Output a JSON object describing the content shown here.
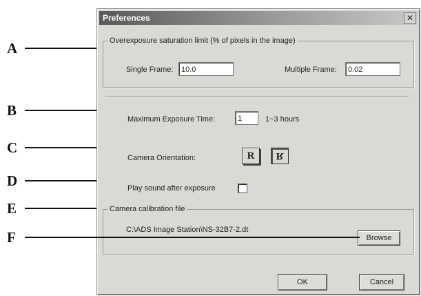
{
  "callouts": [
    "A",
    "B",
    "C",
    "D",
    "E",
    "F"
  ],
  "dialog": {
    "title": "Preferences",
    "close_glyph": "✕",
    "overexposure": {
      "legend": "Overexposure saturation limit (% of pixels in the image)",
      "single_frame_label": "Single Frame:",
      "single_frame_value": "10.0",
      "multiple_frame_label": "Multiple Frame:",
      "multiple_frame_value": "0.02"
    },
    "exposure": {
      "label": "Maximum Exposure Time:",
      "value": "1",
      "units": "1~3 hours"
    },
    "orientation": {
      "label": "Camera Orientation:",
      "normal_glyph": "R",
      "flipped_glyph": "R",
      "selected": "flipped"
    },
    "sound": {
      "label": "Play sound after exposure",
      "checked": false
    },
    "calibration": {
      "legend": "Camera calibration file",
      "path": "C:\\ADS Image Station\\NS-32B7-2.dt",
      "browse_label": "Browse"
    },
    "ok_label": "OK",
    "cancel_label": "Cancel"
  }
}
